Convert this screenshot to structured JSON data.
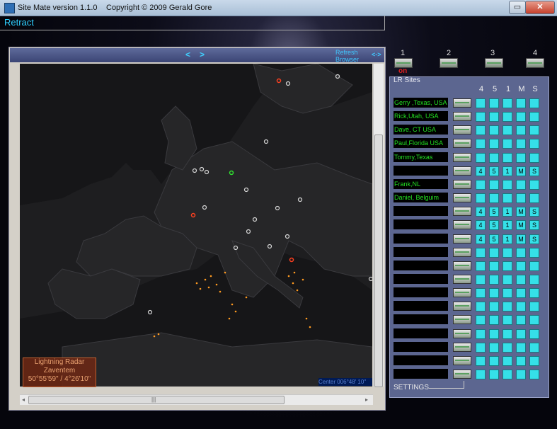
{
  "window": {
    "title": "Site Mate version 1.1.0",
    "copyright": "Copyright © 2009  Gerald Gore",
    "minimize_label": "▭",
    "close_label": "✕"
  },
  "retract": {
    "label": "Retract"
  },
  "browser": {
    "back_label": "<",
    "forward_label": ">",
    "refresh_label": "Refresh Browser",
    "swap_label": "<->",
    "map": {
      "info_lines": [
        "Lightning Radar",
        "Zaventem",
        "50°55'59\" / 4°26'10\""
      ],
      "center_text": "Center 006°48' 10\""
    },
    "scroll_left": "◂",
    "scroll_right": "▸",
    "scroll_grip": "|||"
  },
  "top_buttons": [
    {
      "num": "1"
    },
    {
      "num": "2"
    },
    {
      "num": "3"
    },
    {
      "num": "4"
    }
  ],
  "on_label": "on",
  "lr_sites": {
    "title": "LR Sites",
    "columns": [
      "4",
      "5",
      "1",
      "M",
      "S"
    ],
    "rows": [
      {
        "name": "Gerry ,Texas, USA",
        "labels": false
      },
      {
        "name": "Rick,Utah, USA",
        "labels": false
      },
      {
        "name": "Dave, CT USA",
        "labels": false
      },
      {
        "name": "Paul,Florida USA",
        "labels": false
      },
      {
        "name": "Tommy,Texas",
        "labels": false
      },
      {
        "name": "",
        "labels": true
      },
      {
        "name": "Frank,NL",
        "labels": false
      },
      {
        "name": "Daniel, Belguim",
        "labels": false
      },
      {
        "name": "",
        "labels": true
      },
      {
        "name": "",
        "labels": true
      },
      {
        "name": "",
        "labels": true
      },
      {
        "name": "",
        "labels": false
      },
      {
        "name": "",
        "labels": false
      },
      {
        "name": "",
        "labels": false
      },
      {
        "name": "",
        "labels": false
      },
      {
        "name": "",
        "labels": false
      },
      {
        "name": "",
        "labels": false
      },
      {
        "name": "",
        "labels": false
      },
      {
        "name": "",
        "labels": false
      },
      {
        "name": "",
        "labels": false
      },
      {
        "name": "",
        "labels": false
      }
    ]
  },
  "settings_label": "SETTINGS"
}
